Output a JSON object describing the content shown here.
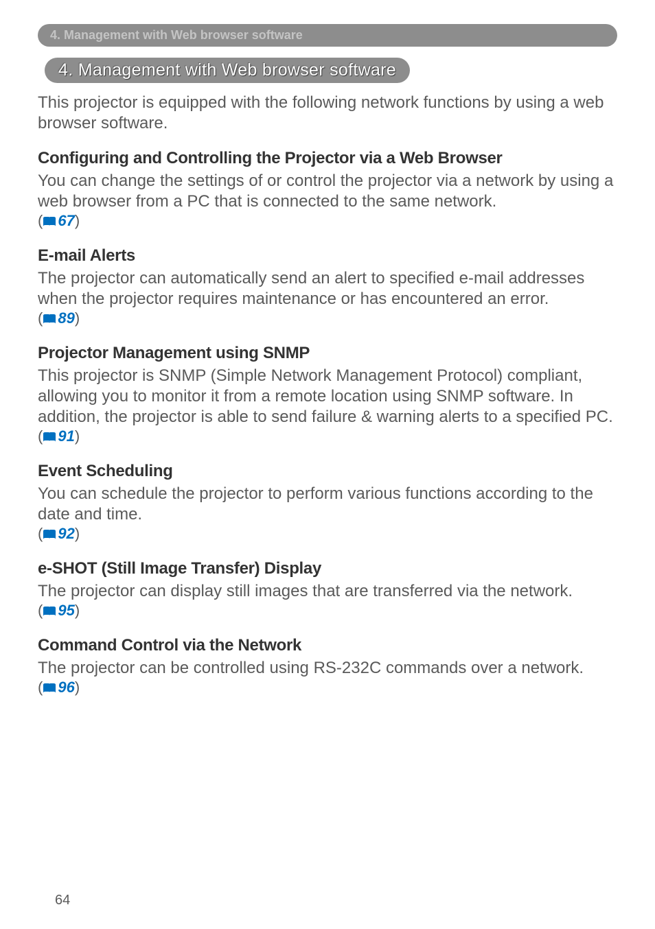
{
  "header_bar": "4. Management with Web browser software",
  "title_pill": "4. Management with Web browser software",
  "intro": "This projector is equipped with the following network functions by using a web browser software.",
  "sections": [
    {
      "heading": "Configuring and Controlling the Projector via a Web Browser",
      "body": "You can change the settings of or control the projector via a network by using a web browser from a PC that is connected to the same network.",
      "ref": "67"
    },
    {
      "heading": "E-mail Alerts",
      "body": "The projector can automatically send an alert to specified e-mail addresses when the projector requires maintenance or has encountered an error.",
      "ref": "89"
    },
    {
      "heading": "Projector Management using SNMP",
      "body": "This projector is SNMP (Simple Network Management Protocol) compliant, allowing you to monitor it from a remote location using SNMP software. In addition, the projector is able to send failure & warning alerts to a specified PC.",
      "ref": "91"
    },
    {
      "heading": "Event Scheduling",
      "body": "You can schedule the projector to perform various functions according to the date and time.",
      "ref": "92"
    },
    {
      "heading": "e-SHOT (Still Image Transfer) Display",
      "body": "The projector can display still images that are transferred via the network.",
      "ref": "95"
    },
    {
      "heading": "Command Control via the Network",
      "body": "The projector can be controlled using RS-232C commands over a network.",
      "ref": "96"
    }
  ],
  "page_number": "64"
}
